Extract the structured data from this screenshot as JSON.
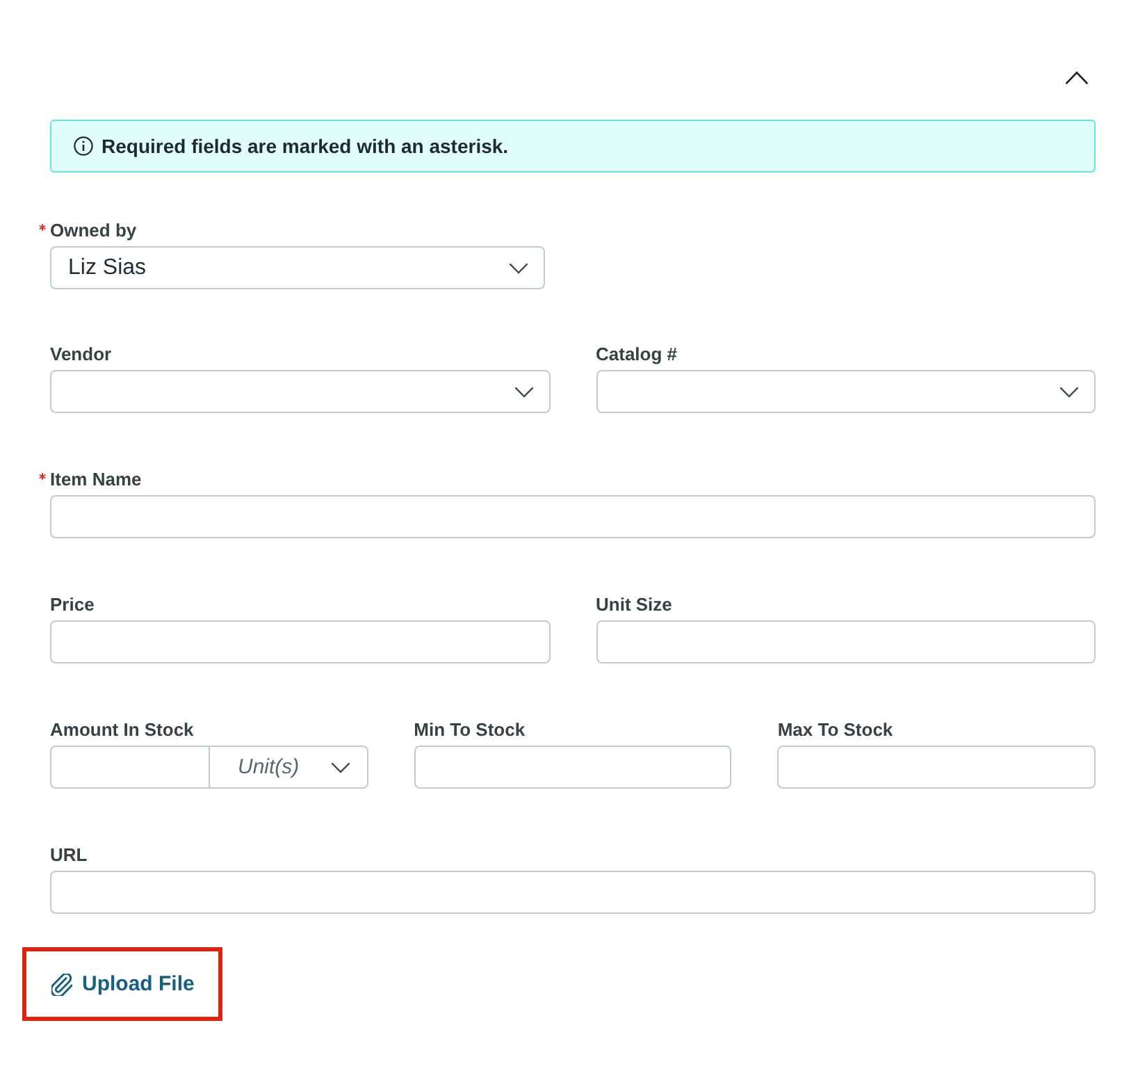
{
  "toggle": {
    "expanded": true
  },
  "notice": {
    "text": "Required fields are marked with an asterisk."
  },
  "owner": {
    "label": "Owned by",
    "required": true,
    "value": "Liz Sias"
  },
  "rows": [
    {
      "fields": [
        {
          "kind": "select",
          "label": "Vendor",
          "required": false
        },
        {
          "kind": "select",
          "label": "Catalog #",
          "required": false
        }
      ]
    },
    {
      "fields": [
        {
          "kind": "text",
          "label": "Item Name",
          "required": true
        }
      ]
    },
    {
      "fields": [
        {
          "kind": "text",
          "label": "Price",
          "required": false
        },
        {
          "kind": "text",
          "label": "Unit Size",
          "required": false
        }
      ]
    },
    {
      "fields": [
        {
          "kind": "quantity",
          "label": "Amount In Stock",
          "required": false,
          "unit": {
            "placeholder": "Unit(s)"
          }
        },
        {
          "kind": "text",
          "label": "Min To Stock",
          "required": false
        },
        {
          "kind": "text",
          "label": "Max To Stock",
          "required": false
        }
      ]
    },
    {
      "fields": [
        {
          "kind": "text",
          "label": "URL",
          "required": false
        }
      ]
    }
  ],
  "upload": {
    "label": "Upload File",
    "highlighted": true
  }
}
